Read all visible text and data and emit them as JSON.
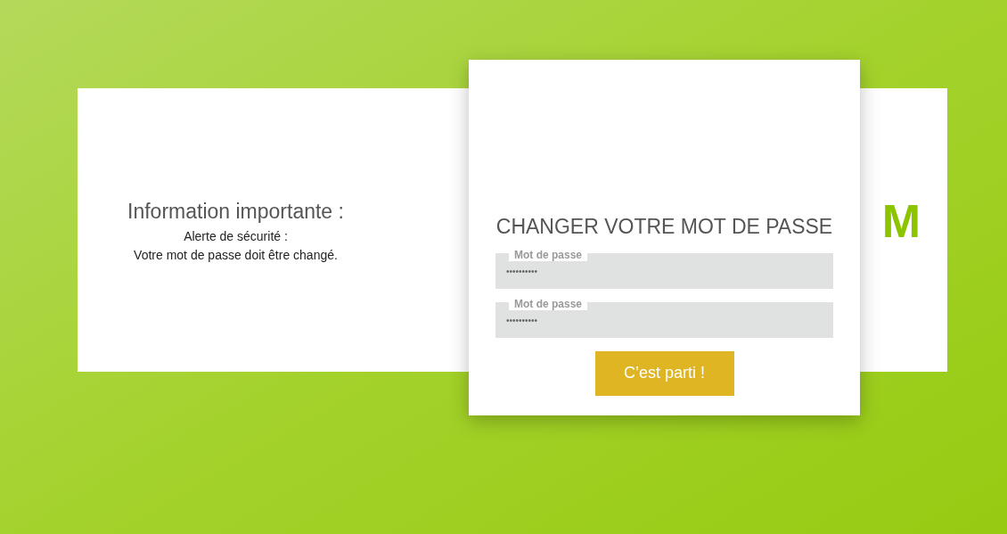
{
  "info": {
    "title": "Information importante :",
    "lines": [
      "Alerte de sécurité :",
      "Votre mot de passe doit être changé."
    ]
  },
  "brand_fragment": "M",
  "dialog": {
    "title": "CHANGER VOTRE MOT DE PASSE",
    "fields": [
      {
        "label": "Mot de passe",
        "value": "••••••••••"
      },
      {
        "label": "Mot de passe",
        "value": "••••••••••"
      }
    ],
    "button": "C’est parti !"
  }
}
